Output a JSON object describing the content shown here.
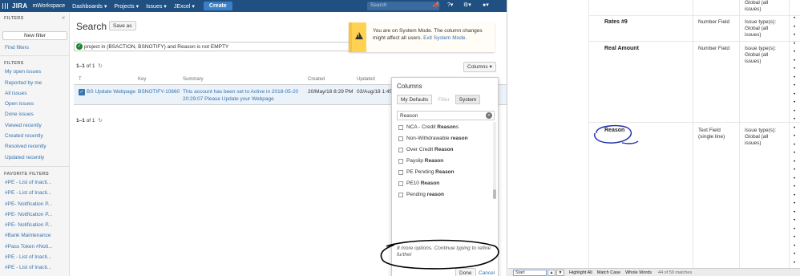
{
  "topbar": {
    "logo": "JIRA",
    "nav": [
      "mWorkspace",
      "Dashboards ▾",
      "Projects ▾",
      "Issues ▾",
      "JExcel ▾"
    ],
    "create_label": "Create",
    "search_placeholder": "Search",
    "icons": [
      "feedback-icon",
      "help-icon",
      "settings-icon",
      "avatar"
    ]
  },
  "sidebar": {
    "filters_heading": "FILTERS",
    "new_filter_label": "New filter",
    "find_filters_label": "Find filters",
    "filters_heading_2": "FILTERS",
    "system_filters": [
      "My open issues",
      "Reported by me",
      "All issues",
      "Open issues",
      "Done issues",
      "Viewed recently",
      "Created recently",
      "Resolved recently",
      "Updated recently"
    ],
    "favorite_heading": "FAVORITE FILTERS",
    "favorite_filters": [
      "#PE - List of Inacti...",
      "#PE - List of Inacti...",
      "#PE- Notification P...",
      "#PE- Notification P...",
      "#PE- Notification P...",
      "#Bank Maintenance",
      "#Pass Token #Noti...",
      "#PE - List of Inacti...",
      "#PE - List of Inacti..."
    ]
  },
  "main": {
    "title": "Search",
    "save_as_label": "Save as",
    "query": "project in (BSACTION, BSNOTIFY) and Reason is not EMPTY",
    "count_top_bold": "1–1",
    "count_top_rest": " of 1",
    "count_bottom_bold": "1–1",
    "count_bottom_rest": " of 1",
    "columns_button_label": "Columns ▾",
    "table_headers": {
      "t": "T",
      "key": "Key",
      "summary": "Summary",
      "created": "Created",
      "updated": "Updated"
    },
    "row": {
      "issue_type": "BS Update Webpage",
      "key": "BSNOTIFY-10860",
      "summary_line1": "This account has been set to Active in 2018-05-20",
      "summary_line2": "20:29:07   Please Update your Webpage",
      "created": "20/May/18 8:29 PM",
      "updated": "03/Aug/18 1:45"
    }
  },
  "notice": {
    "text": "You are on System Mode. The column changes might affect all users.",
    "link": "Exit System Mode."
  },
  "columns_popup": {
    "title": "Columns",
    "tabs": [
      "My Defaults",
      "Filter",
      "System"
    ],
    "search_value": "Reason",
    "options": [
      {
        "prefix": "NCA - Credit ",
        "match": "Reason",
        "suffix": "s"
      },
      {
        "prefix": "Non-Withdrawable ",
        "match": "reason",
        "suffix": ""
      },
      {
        "prefix": "Over Credit ",
        "match": "Reason",
        "suffix": ""
      },
      {
        "prefix": "Payslip ",
        "match": "Reason",
        "suffix": ""
      },
      {
        "prefix": "PE Pending ",
        "match": "Reason",
        "suffix": ""
      },
      {
        "prefix": "PE10 ",
        "match": "Reason",
        "suffix": ""
      },
      {
        "prefix": "Pending ",
        "match": "reason",
        "suffix": ""
      }
    ],
    "more_text": "8 more options. Continue typing to refine further",
    "done_label": "Done",
    "cancel_label": "Cancel"
  },
  "doc": {
    "rows": [
      {
        "name": "",
        "ftype": "",
        "ctx": [
          "Global (all",
          "issues)"
        ]
      },
      {
        "name": "Rates #9",
        "ftype": "Number Field",
        "ctx": [
          "Issue type(s):",
          "Global (all",
          "issues)"
        ]
      },
      {
        "name": "Real Amount",
        "ftype": "Number Field",
        "ctx": [
          "Issue type(s):",
          "Global (all",
          "issues)"
        ]
      },
      {
        "name": "Reason",
        "ftype": "Text Field (single line)",
        "ctx": [
          "Issue type(s):",
          "Global (all",
          "issues)"
        ]
      }
    ]
  },
  "findbar": {
    "value": "Start",
    "prev": "▲",
    "next": "▼",
    "highlight_all": "Highlight All",
    "match_case": "Match Case",
    "whole_words": "Whole Words",
    "status": "44 of 59 matches"
  },
  "colors": {
    "topbar": "#205081",
    "link": "#3572b0",
    "notice": "#ffd351",
    "row_selected": "#ebf2f9"
  }
}
